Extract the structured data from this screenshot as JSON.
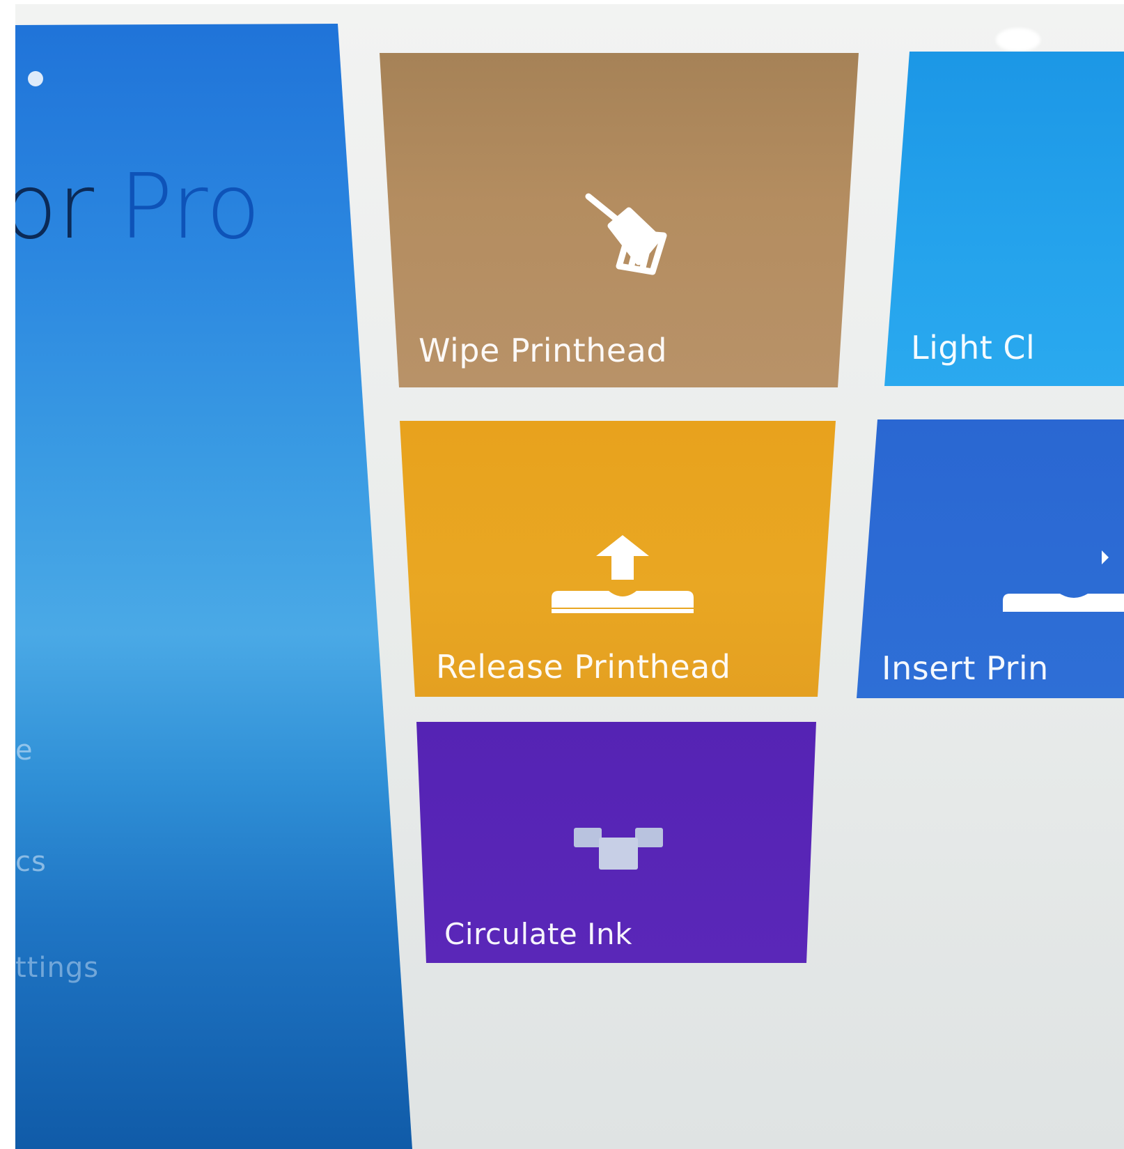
{
  "app": {
    "title_prefix": "or",
    "title_pro": "Pro"
  },
  "sidebar": {
    "items": [
      {
        "label": "e"
      },
      {
        "label": "cs"
      },
      {
        "label": "ttings"
      }
    ]
  },
  "tiles": [
    {
      "label": "Wipe Printhead",
      "icon": "broom-icon",
      "color": "#b08a5e"
    },
    {
      "label": "Light Cl",
      "icon": "",
      "color": "#25a3ec"
    },
    {
      "label": "Release Printhead",
      "icon": "release-printhead-icon",
      "color": "#e8a421"
    },
    {
      "label": "Insert Prin",
      "icon": "insert-printhead-icon",
      "color": "#2c6bd4"
    },
    {
      "label": "Circulate Ink",
      "icon": "circulate-ink-icon",
      "color": "#5725b6"
    }
  ]
}
